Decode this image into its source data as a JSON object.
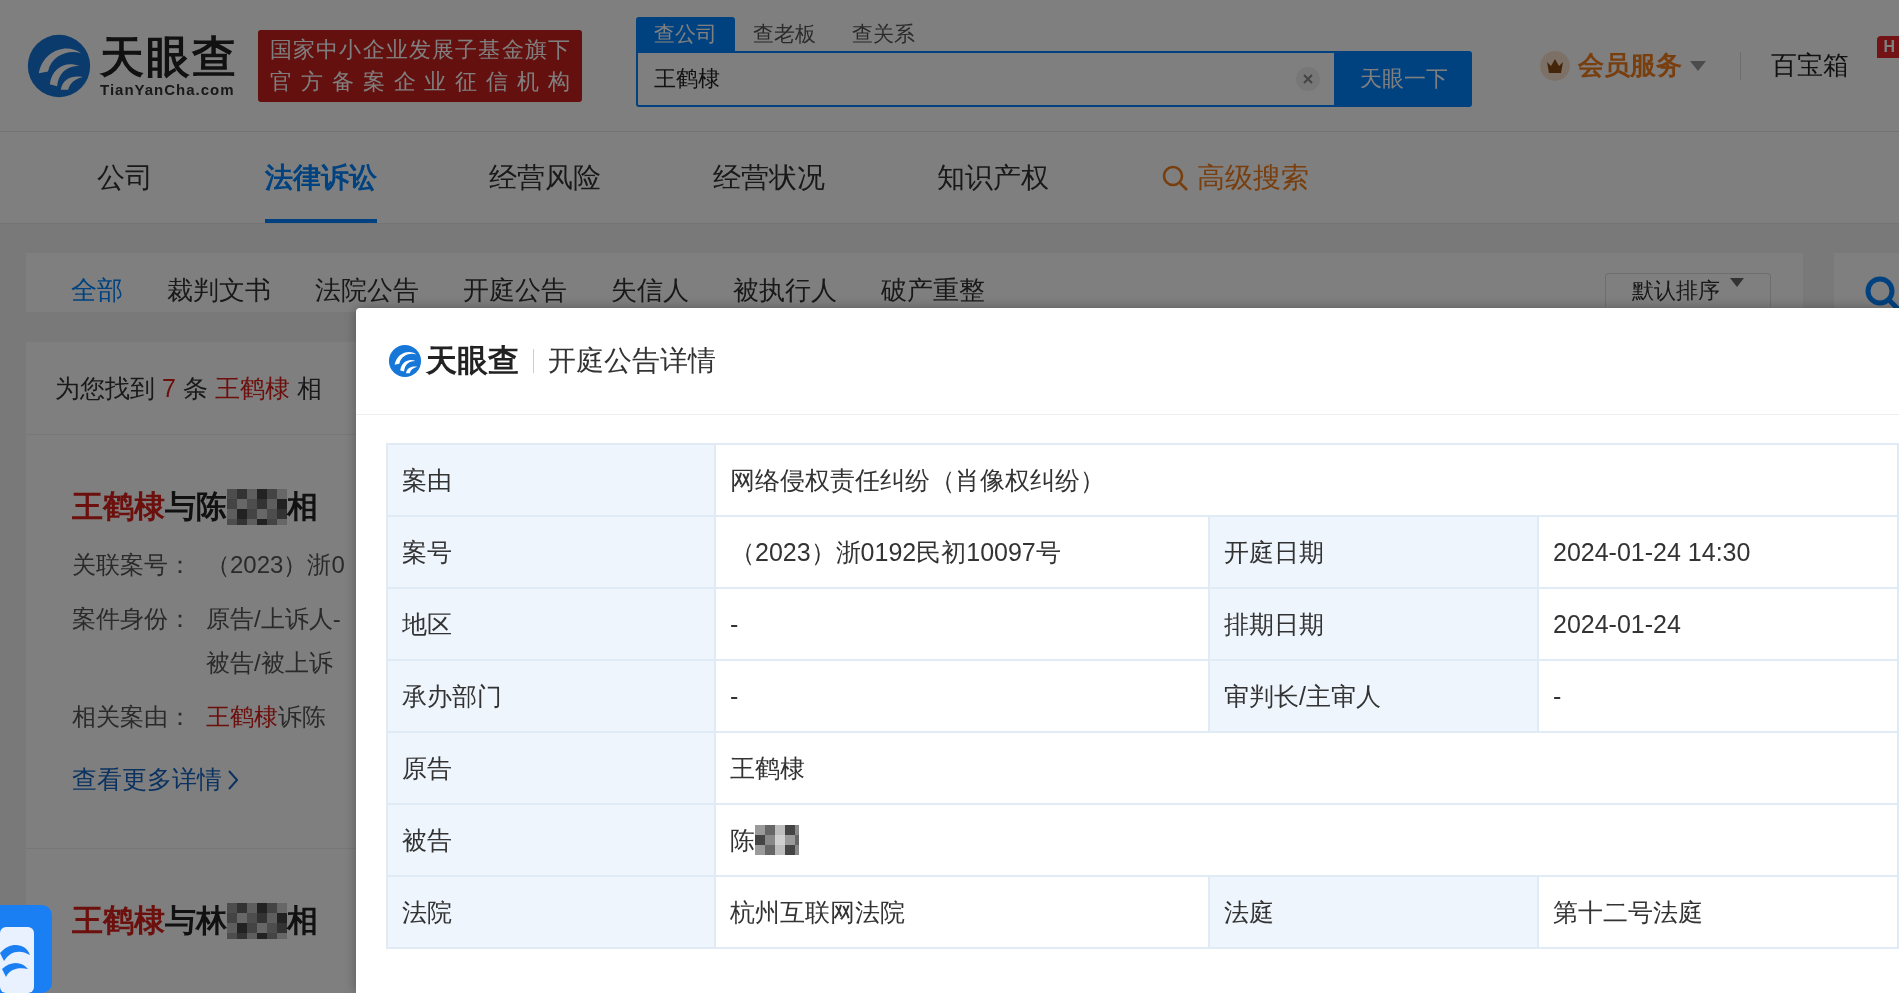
{
  "header": {
    "logo": {
      "name": "天眼查",
      "domain": "TianYanCha.com"
    },
    "badge": [
      "国家中小企业发展子基金旗下",
      "官方备案企业征信机构"
    ],
    "search": {
      "tabs": [
        {
          "label": "查公司",
          "selected": true
        },
        {
          "label": "查老板",
          "selected": false
        },
        {
          "label": "查关系",
          "selected": false
        }
      ],
      "value": "王鹤棣",
      "button": "天眼一下"
    },
    "vip": "会员服务",
    "toolbox": "百宝箱",
    "hot_badge": "H"
  },
  "nav": [
    {
      "kind": "tab",
      "label": "公司",
      "selected": false
    },
    {
      "kind": "tab",
      "label": "法律诉讼",
      "selected": true
    },
    {
      "kind": "tab",
      "label": "经营风险",
      "selected": false
    },
    {
      "kind": "tab",
      "label": "经营状况",
      "selected": false
    },
    {
      "kind": "tab",
      "label": "知识产权",
      "selected": false
    },
    {
      "kind": "search",
      "label": "高级搜索",
      "selected": false
    }
  ],
  "filters": {
    "tabs": [
      {
        "label": "全部",
        "selected": true
      },
      {
        "label": "裁判文书",
        "selected": false
      },
      {
        "label": "法院公告",
        "selected": false
      },
      {
        "label": "开庭公告",
        "selected": false
      },
      {
        "label": "失信人",
        "selected": false
      },
      {
        "label": "被执行人",
        "selected": false
      },
      {
        "label": "破产重整",
        "selected": false
      }
    ],
    "sort": "默认排序"
  },
  "results": {
    "summary": [
      {
        "text": "为您找到 ",
        "highlight": false
      },
      {
        "text": "7",
        "highlight": true
      },
      {
        "text": " 条 ",
        "highlight": false
      },
      {
        "text": "王鹤棣",
        "highlight": true
      },
      {
        "text": " 相",
        "highlight": false
      }
    ],
    "cases": [
      {
        "name": "王鹤棣",
        "title": "与陈",
        "title_end": "相",
        "fields": [
          {
            "label": "关联案号：",
            "lines": [
              [
                {
                  "text": "（2023）浙0",
                  "highlight": false
                }
              ]
            ]
          },
          {
            "label": "案件身份：",
            "lines": [
              [
                {
                  "text": "原告/上诉人-",
                  "highlight": false
                }
              ],
              [
                {
                  "text": "被告/被上诉",
                  "highlight": false
                }
              ]
            ]
          },
          {
            "label": "相关案由：",
            "lines": [
              [
                {
                  "text": "王鹤棣",
                  "highlight": true
                },
                {
                  "text": "诉陈",
                  "highlight": false
                }
              ]
            ]
          }
        ],
        "more": "查看更多详情"
      },
      {
        "name": "王鹤棣",
        "title": "与林",
        "title_end": "相"
      }
    ]
  },
  "modal": {
    "logo": "天眼查",
    "title": "开庭公告详情",
    "rows": [
      {
        "pairs": [
          {
            "label": "案由",
            "value": "网络侵权责任纠纷（肖像权纠纷）"
          }
        ]
      },
      {
        "pairs": [
          {
            "label": "案号",
            "value": "（2023）浙0192民初10097号"
          },
          {
            "label": "开庭日期",
            "value": "2024-01-24 14:30"
          }
        ]
      },
      {
        "pairs": [
          {
            "label": "地区",
            "value": "-"
          },
          {
            "label": "排期日期",
            "value": "2024-01-24"
          }
        ]
      },
      {
        "pairs": [
          {
            "label": "承办部门",
            "value": "-"
          },
          {
            "label": "审判长/主审人",
            "value": "-"
          }
        ]
      },
      {
        "pairs": [
          {
            "label": "原告",
            "value": "王鹤棣"
          }
        ]
      },
      {
        "pairs": [
          {
            "label": "被告",
            "value": "陈",
            "redacted": true
          }
        ]
      },
      {
        "pairs": [
          {
            "label": "法院",
            "value": "杭州互联网法院"
          },
          {
            "label": "法庭",
            "value": "第十二号法庭"
          }
        ]
      }
    ]
  }
}
